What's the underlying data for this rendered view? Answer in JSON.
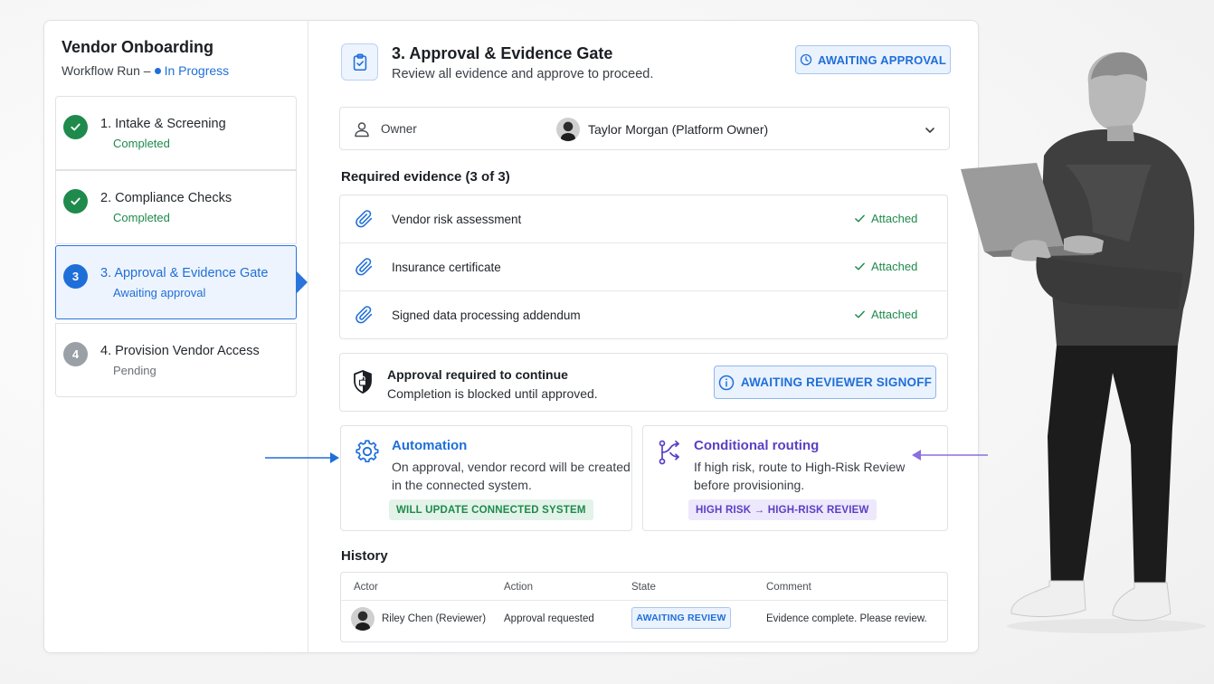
{
  "workflow": {
    "title": "Vendor Onboarding",
    "subtitle_prefix": "Workflow Run –",
    "status": "In Progress"
  },
  "steps": [
    {
      "number": "1",
      "title": "1.  Intake & Screening",
      "state": "Completed",
      "status": "done"
    },
    {
      "number": "2",
      "title": "2. Compliance Checks",
      "state": "Completed",
      "status": "done"
    },
    {
      "number": "3",
      "title": "3. Approval & Evidence Gate",
      "state": "Awaiting approval",
      "status": "active"
    },
    {
      "number": "4",
      "title": "4. Provision Vendor Access",
      "state": "Pending",
      "status": "pending"
    }
  ],
  "gate": {
    "title": "3. Approval & Evidence Gate",
    "subtitle": "Review all evidence and approve to proceed.",
    "badge": "AWAITING APPROVAL"
  },
  "owner": {
    "label": "Owner",
    "name": "Taylor Morgan (Platform Owner)"
  },
  "evidence": {
    "title": "Required evidence (3 of 3)",
    "items": [
      {
        "name": "Vendor risk assessment",
        "status": "Attached"
      },
      {
        "name": "Insurance certificate",
        "status": "Attached"
      },
      {
        "name": "Signed data processing addendum",
        "status": "Attached"
      }
    ]
  },
  "approval": {
    "title": "Approval required to continue",
    "subtitle": "Completion is blocked until approved.",
    "badge": "AWAITING REVIEWER SIGNOFF"
  },
  "automation": {
    "title": "Automation",
    "text": "On approval, vendor record will be created in the connected system.",
    "badge": "WILL UPDATE CONNECTED SYSTEM"
  },
  "routing": {
    "title": "Conditional routing",
    "text": "If high risk, route to High-Risk Review before provisioning.",
    "badge": "HIGH RISK → HIGH-RISK REVIEW"
  },
  "history": {
    "title": "History",
    "columns": [
      "Actor",
      "Action",
      "State",
      "Comment"
    ],
    "rows": [
      {
        "actor": "Riley Chen (Reviewer)",
        "action": "Approval requested",
        "state": "AWAITING REVIEW",
        "comment": "Evidence complete. Please review."
      }
    ]
  },
  "colors": {
    "accent": "#1f6fd9",
    "success": "#1e8a4c",
    "routing": "#5b3fc4",
    "pending": "#9aa0a6"
  }
}
